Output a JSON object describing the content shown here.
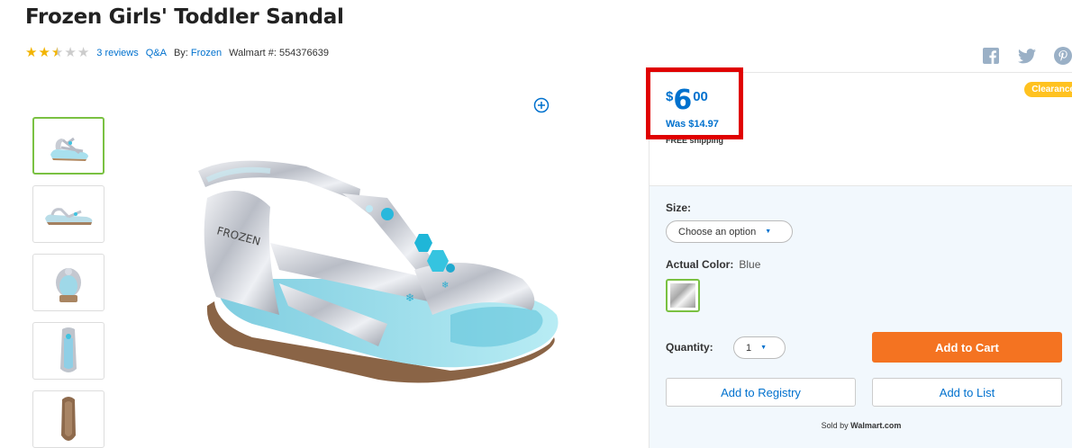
{
  "product": {
    "title": "Frozen Girls' Toddler Sandal",
    "rating": 2.5,
    "rating_max": 5,
    "reviews_label": "3 reviews",
    "qa_label": "Q&A",
    "by_label": "By:",
    "brand": "Frozen",
    "walmart_number_label": "Walmart #: 554376639"
  },
  "price": {
    "currency": "$",
    "dollars": "6",
    "cents": "00",
    "was": "Was $14.97",
    "shipping": "FREE shipping",
    "badge": "Clearance"
  },
  "options": {
    "size_label": "Size:",
    "size_placeholder": "Choose an option",
    "color_label": "Actual Color:",
    "color_value": "Blue",
    "quantity_label": "Quantity:",
    "quantity_value": "1"
  },
  "actions": {
    "add_to_cart": "Add to Cart",
    "add_to_registry": "Add to Registry",
    "add_to_list": "Add to List"
  },
  "seller": {
    "prefix": "Sold by",
    "name": "Walmart.com"
  },
  "social": [
    "facebook-icon",
    "twitter-icon",
    "pinterest-icon"
  ],
  "colors": {
    "brand_blue": "#0071ce",
    "cart_orange": "#f47321",
    "highlight_red": "#e00000",
    "badge_yellow": "#ffc220",
    "star_gold": "#f2b400",
    "active_green": "#7ac142"
  }
}
